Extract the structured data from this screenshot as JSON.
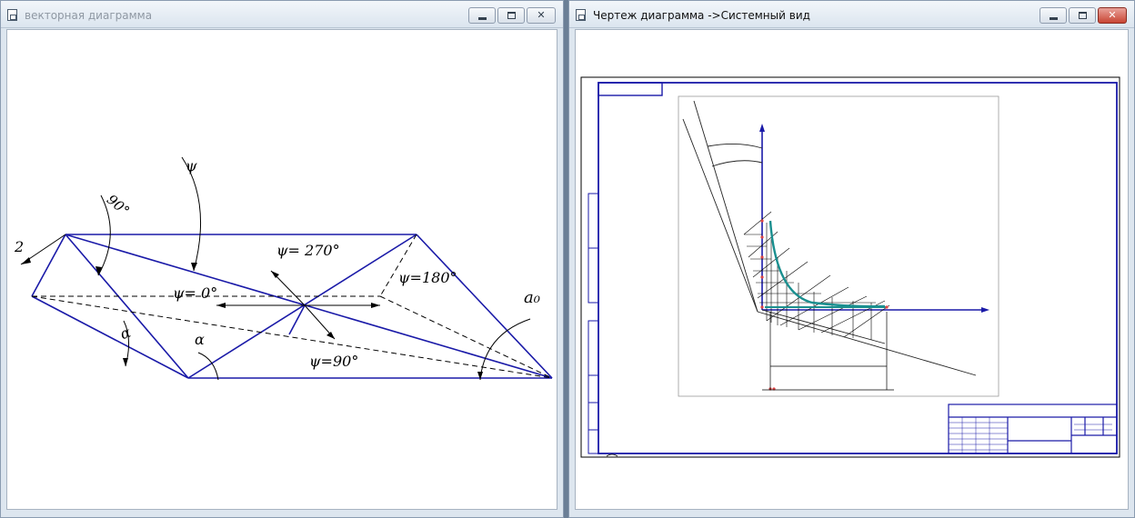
{
  "windows": {
    "left": {
      "title": "векторная диаграмма",
      "labels": {
        "psi": "ψ",
        "angle90": "90°",
        "two": "2",
        "psi270": "ψ= 270°",
        "psi180": "ψ=180°",
        "psi0": "ψ= 0°",
        "alpha1": "α",
        "alpha2": "α",
        "psi90": "ψ=90°",
        "a0": "a₀"
      }
    },
    "right": {
      "title": "Чертеж диаграмма ->Системный вид"
    }
  },
  "colors": {
    "drawing_blue": "#1a1aa8",
    "curve_teal": "#1a8f8f",
    "close_red": "#c84533"
  }
}
